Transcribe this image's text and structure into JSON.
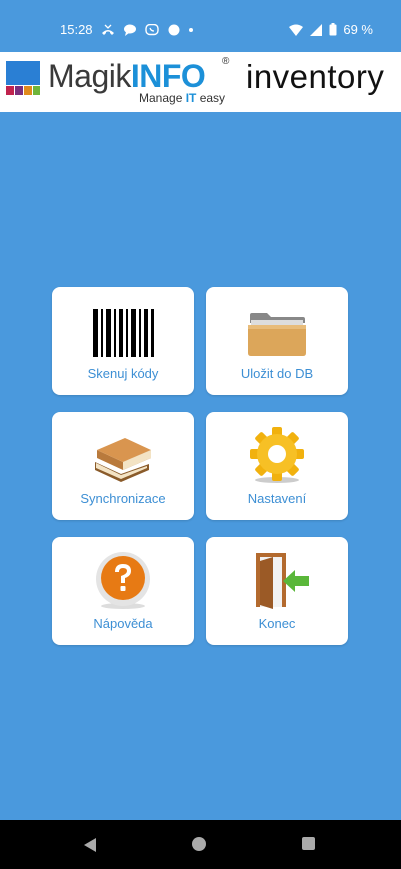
{
  "status_bar": {
    "time": "15:28",
    "battery": "69 %"
  },
  "header": {
    "brand_a": "Magik",
    "brand_b": "INFO",
    "reg_mark": "®",
    "tagline_a": "Manage ",
    "tagline_b": "IT",
    "tagline_c": " easy",
    "app_word": "inventory"
  },
  "menu": {
    "scan": {
      "label": "Skenuj kódy",
      "icon": "barcode-icon"
    },
    "save": {
      "label": "Uložit do DB",
      "icon": "folder-icon"
    },
    "sync": {
      "label": "Synchronizace",
      "icon": "books-icon"
    },
    "settings": {
      "label": "Nastavení",
      "icon": "gear-icon"
    },
    "help": {
      "label": "Nápověda",
      "icon": "question-icon"
    },
    "exit": {
      "label": "Konec",
      "icon": "exit-door-icon"
    }
  },
  "colors": {
    "background": "#4a99dd",
    "accent": "#3d8fd4",
    "brand_blue": "#1c90d8"
  }
}
